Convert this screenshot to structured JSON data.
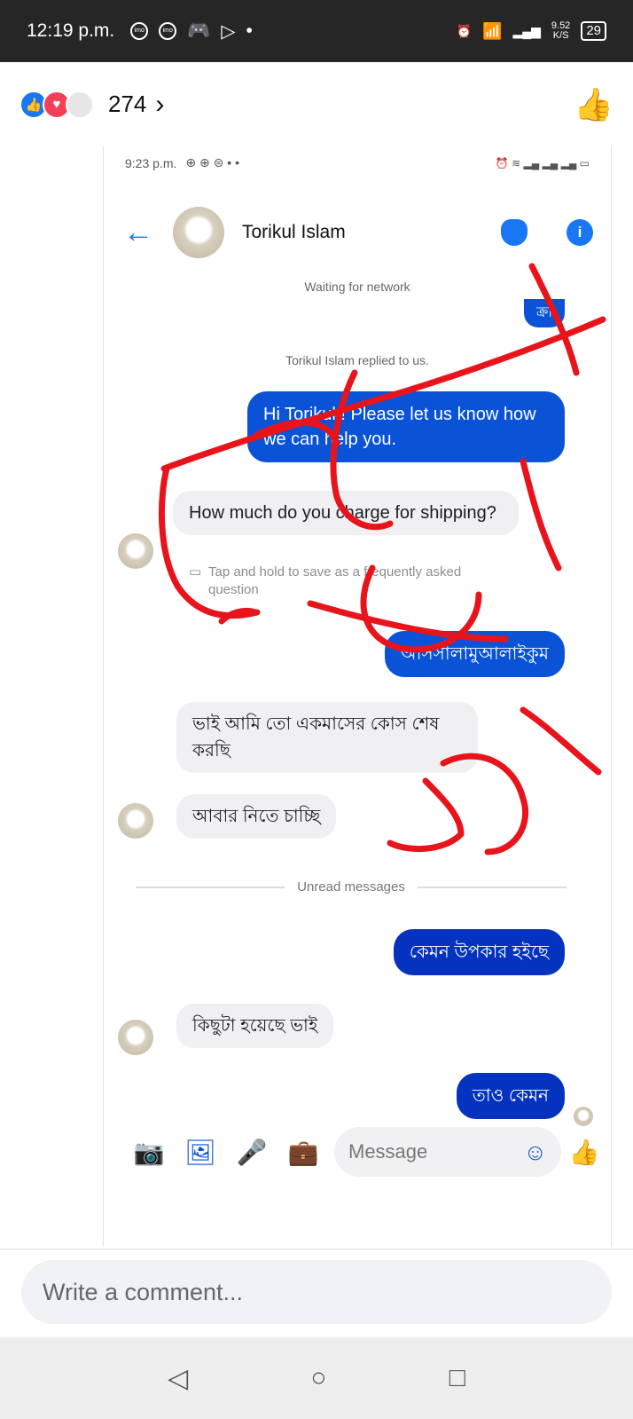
{
  "status_bar": {
    "time": "12:19 p.m.",
    "left_icons": [
      "imo",
      "imo",
      "gamepad-icon",
      "play-icon",
      "•"
    ],
    "net_speed_top": "9.52",
    "net_speed_bottom": "K/S",
    "battery": "29"
  },
  "reactions": {
    "icons": [
      "like-reaction-icon",
      "love-reaction-icon",
      "other-reaction-icon"
    ],
    "count": "274"
  },
  "chat": {
    "inner_status": {
      "time": "9:23 p.m."
    },
    "contact_name": "Torikul Islam",
    "network_status": "Waiting for network",
    "partial_bubble": "ক্রা",
    "reply_notice": "Torikul Islam replied to us.",
    "messages": [
      {
        "dir": "out",
        "text": "Hi Torikul ! Please let us know how we can help you."
      },
      {
        "dir": "in",
        "text": "How much do you charge for shipping?"
      },
      {
        "dir": "out",
        "text": "আসসালামুআলাইকুম"
      },
      {
        "dir": "in",
        "text": "ভাই আমি তো একমাসের কোস শেষ করছি"
      },
      {
        "dir": "in",
        "text": "আবার নিতে চাচ্ছি"
      },
      {
        "dir": "out",
        "text": "কেমন উপকার হইছে"
      },
      {
        "dir": "in",
        "text": "কিছুটা হয়েছে ভাই"
      },
      {
        "dir": "out",
        "text": "তাও কেমন"
      }
    ],
    "faq_hint": "Tap and hold to save as a frequently asked question",
    "unread_divider": "Unread messages",
    "composer_placeholder": "Message"
  },
  "comment": {
    "placeholder": "Write a comment..."
  },
  "colors": {
    "accent": "#1877f2",
    "bubble_out": "#0a53d6",
    "scribble": "#e8141c"
  }
}
